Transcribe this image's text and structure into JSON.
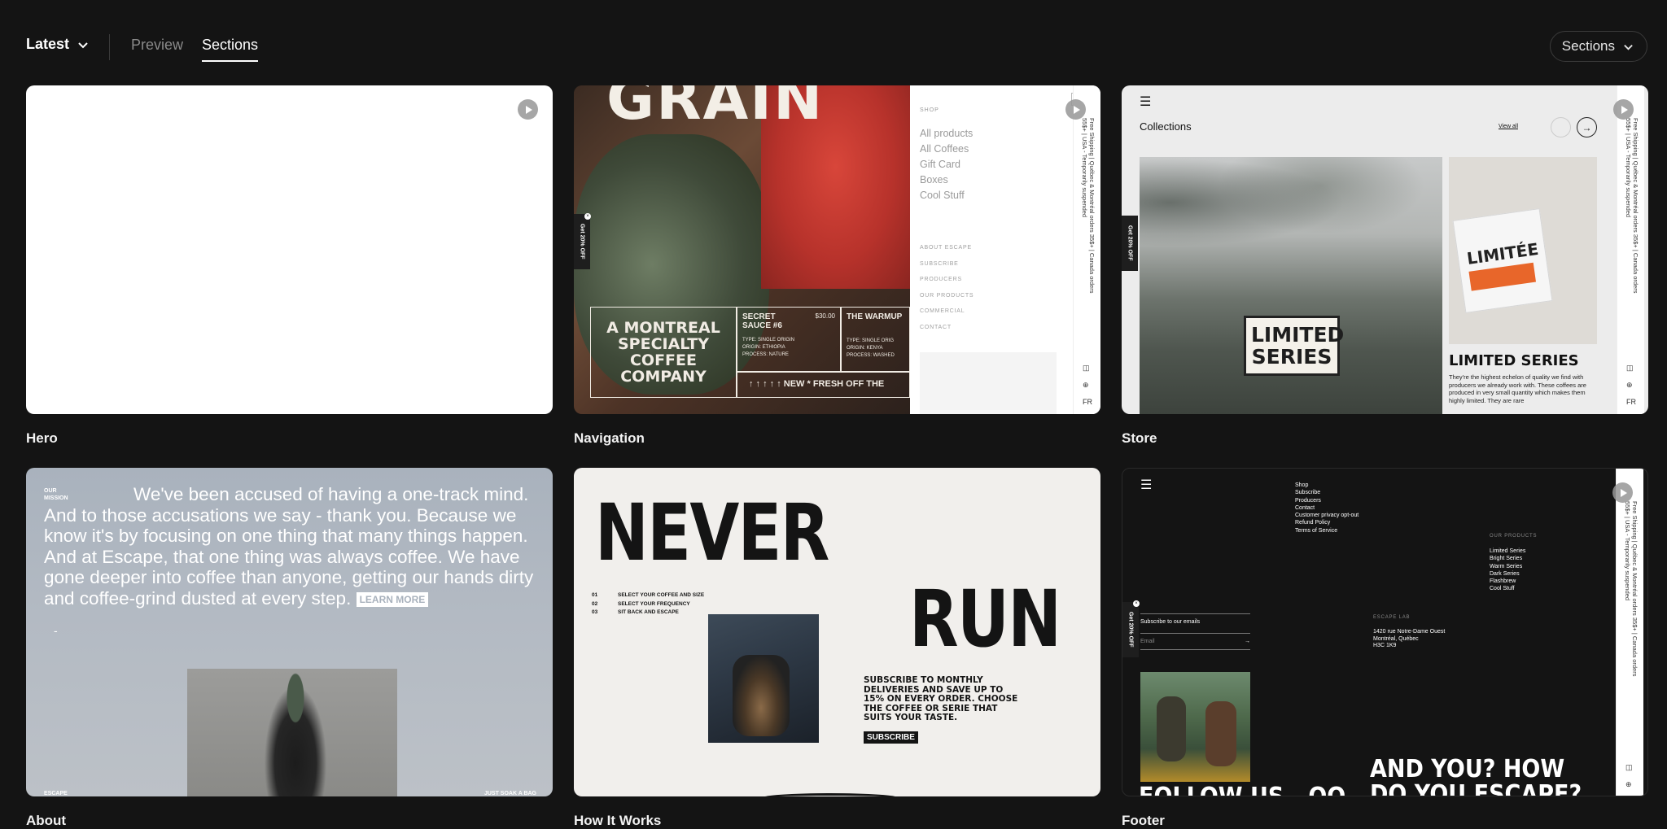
{
  "toolbar": {
    "latest_label": "Latest",
    "preview_tab": "Preview",
    "sections_tab": "Sections",
    "sections_dropdown": "Sections"
  },
  "cards": [
    {
      "label": "Hero"
    },
    {
      "label": "Navigation"
    },
    {
      "label": "Store"
    },
    {
      "label": "About"
    },
    {
      "label": "How It Works"
    },
    {
      "label": "Footer"
    }
  ],
  "navigation_preview": {
    "hero_word": "GRAIN",
    "tagline": "A MONTREAL SPECIALTY COFFEE COMPANY",
    "product1_name": "SECRET SAUCE #6",
    "product1_price": "$30.00",
    "product1_rows": [
      "TYPE: SINGLE ORIGIN",
      "ORIGIN: ETHIOPIA",
      "PROCESS: NATURE"
    ],
    "product2_name": "THE WARMUP",
    "product2_rows": [
      "TYPE: SINGLE ORIG",
      "ORIGIN: KENYA",
      "PROCESS: WASHED"
    ],
    "ticker": "NEW * FRESH OFF THE",
    "side_tab": "Get 20% OFF",
    "menu_shop": "SHOP",
    "menu_items": [
      "All products",
      "All Coffees",
      "Gift Card",
      "Boxes",
      "Cool Stuff"
    ],
    "menu_small": [
      "ABOUT ESCAPE",
      "SUBSCRIBE",
      "PRODUCERS",
      "OUR PRODUCTS",
      "COMMERCIAL",
      "CONTACT"
    ],
    "rail_text": "Free Shipping | Québec & Montréal orders 35$+ | Canada orders 55$+ | USA - Temporarily suspended",
    "rail_lang": "FR"
  },
  "store_preview": {
    "heading": "Collections",
    "view_all": "View all",
    "badge": "LIMITED SERIES",
    "bag_text": "LIMITÉE",
    "product_title": "LIMITED SERIES",
    "product_desc": "They're the highest echelon of quality we find with producers we already work with. These coffees are produced in very small quantity which makes them highly limited. They are rare",
    "side_tab": "Get 20% OFF",
    "rail_lang": "FR"
  },
  "about_preview": {
    "mission_label": "OUR MISSION",
    "body": "We've been accused of having a one-track mind. And to those accusations we say - thank you. Because we know it's by focusing on one thing that many things happen. And at Escape, that one thing was always coffee. We have gone deeper into coffee than anyone, getting our hands dirty and coffee-grind dusted at every step.",
    "learn_more": "LEARN MORE",
    "dash": "-",
    "footer_left": "ESCAPE",
    "footer_right": "JUST SOAK A BAG"
  },
  "how_preview": {
    "word1": "NEVER",
    "word2": "RUN",
    "steps": [
      {
        "num": "01",
        "text": "SELECT YOUR COFFEE AND SIZE"
      },
      {
        "num": "02",
        "text": "SELECT YOUR FREQUENCY"
      },
      {
        "num": "03",
        "text": "SIT BACK AND ESCAPE"
      }
    ],
    "subscribe_text": "SUBSCRIBE TO MONTHLY DELIVERIES AND SAVE UP TO 15% ON EVERY ORDER. CHOOSE THE COFFEE OR SERIE THAT SUITS YOUR TASTE.",
    "subscribe_button": "SUBSCRIBE"
  },
  "footer_preview": {
    "links": [
      "Shop",
      "Subscribe",
      "Producers",
      "Contact",
      "Customer privacy opt-out",
      "Refund Policy",
      "Terms of Service"
    ],
    "products_heading": "OUR PRODUCTS",
    "products": [
      "Limited Series",
      "Bright Series",
      "Warm Series",
      "Dark Series",
      "Flashbrew",
      "Cool Stuff"
    ],
    "lab_heading": "ESCAPE LAB",
    "lab_address": [
      "1420 rue Notre-Dame Ouest",
      "Montréal, Québec",
      "H3C 1K9"
    ],
    "subscribe_label": "Subscribe to our emails",
    "email_placeholder": "Email",
    "big_heading": "AND YOU? HOW DO YOU ESCAPE?",
    "follow": "FOLLOW US - OO",
    "side_tab": "Get 20% OFF"
  }
}
